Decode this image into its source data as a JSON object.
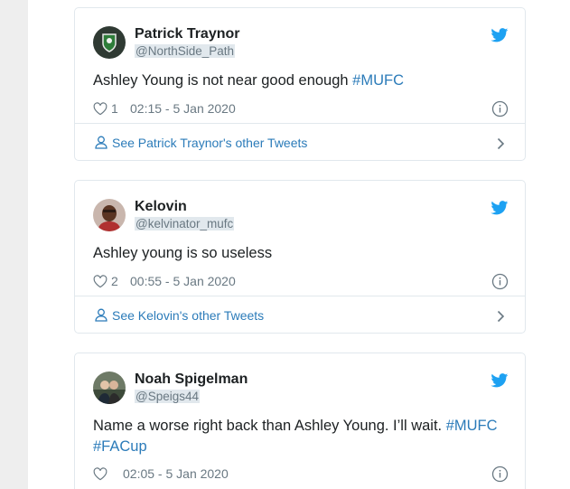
{
  "tweets": [
    {
      "name": "Patrick Traynor",
      "handle": "@NorthSide_Path",
      "text": "Ashley Young is not near good enough ",
      "hashtags": [
        "#MUFC"
      ],
      "likes": "1",
      "timestamp": "02:15 - 5 Jan 2020",
      "footer": "See Patrick Traynor's other Tweets"
    },
    {
      "name": "Kelovin",
      "handle": "@kelvinator_mufc",
      "text": "Ashley young is so useless",
      "hashtags": [],
      "likes": "2",
      "timestamp": "00:55 - 5 Jan 2020",
      "footer": "See Kelovin's other Tweets"
    },
    {
      "name": "Noah Spigelman",
      "handle": "@Speigs44",
      "text": "Name a worse right back than Ashley Young. I’ll wait. ",
      "hashtags": [
        "#MUFC",
        "#FACup"
      ],
      "likes": "",
      "timestamp": "02:05 - 5 Jan 2020",
      "footer": ""
    }
  ],
  "colors": {
    "link": "#2b7bb9",
    "twitter_blue": "#1da1f2",
    "muted": "#697882",
    "border": "#e1e8ed"
  },
  "icons": [
    "twitter-bird-icon",
    "heart-icon",
    "info-icon",
    "person-icon",
    "chevron-right-icon"
  ]
}
